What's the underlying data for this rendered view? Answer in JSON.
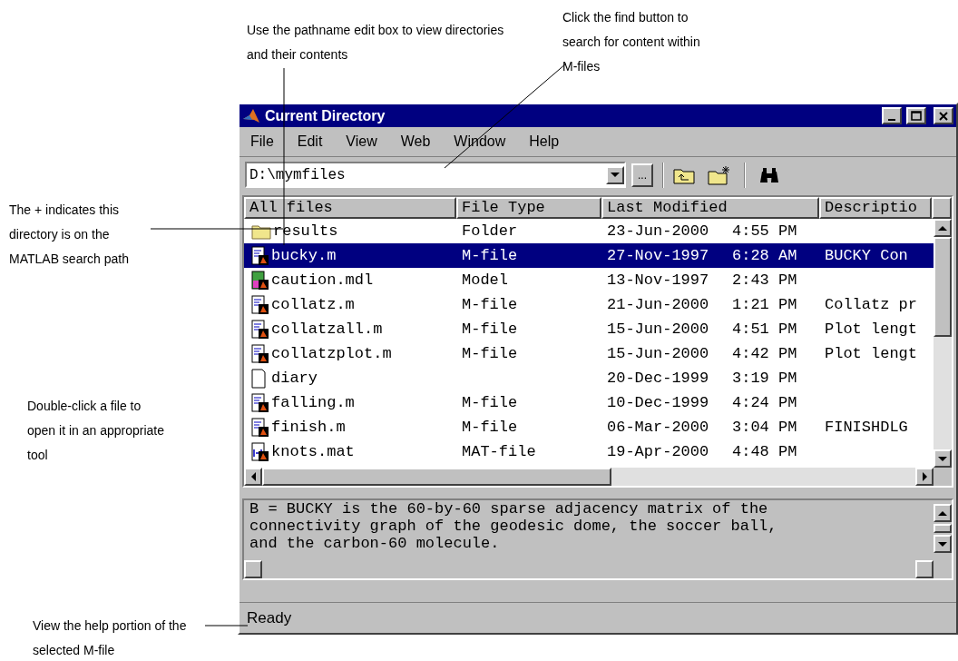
{
  "callouts": [
    {
      "kind": "pathname",
      "text": "Use the pathname edit box to view directories and their contents"
    },
    {
      "kind": "find",
      "text": "Click the find button to search for content within M-files"
    },
    {
      "kind": "plus",
      "text": "The + indicates this directory is on the MATLAB search path"
    },
    {
      "kind": "open",
      "text": "Double-click a file to open it in an appropriate tool"
    },
    {
      "kind": "help",
      "text": "View the help portion of the selected M-file"
    }
  ],
  "window": {
    "title": "Current Directory",
    "menu": [
      "File",
      "Edit",
      "View",
      "Web",
      "Window",
      "Help"
    ],
    "path": {
      "value": "D:\\mymfiles",
      "browse": "..."
    },
    "columns": [
      "All files",
      "File Type",
      "Last Modified",
      "Descriptio"
    ],
    "rows": [
      {
        "kind": "folder",
        "name": "results",
        "type": "Folder",
        "date": "23-Jun-2000",
        "time": "4:55 PM",
        "description": "",
        "selected": false
      },
      {
        "kind": "mfile",
        "name": "bucky.m",
        "type": "M-file",
        "date": "27-Nov-1997",
        "time": "6:28 AM",
        "description": "BUCKY  Con",
        "selected": true
      },
      {
        "kind": "model",
        "name": "caution.mdl",
        "type": "Model",
        "date": "13-Nov-1997",
        "time": "2:43 PM",
        "description": "",
        "selected": false
      },
      {
        "kind": "mfile",
        "name": "collatz.m",
        "type": "M-file",
        "date": "21-Jun-2000",
        "time": "1:21 PM",
        "description": "Collatz pr",
        "selected": false
      },
      {
        "kind": "mfile",
        "name": "collatzall.m",
        "type": "M-file",
        "date": "15-Jun-2000",
        "time": "4:51 PM",
        "description": "Plot lengt",
        "selected": false
      },
      {
        "kind": "mfile",
        "name": "collatzplot.m",
        "type": "M-file",
        "date": "15-Jun-2000",
        "time": "4:42 PM",
        "description": "Plot lengt",
        "selected": false
      },
      {
        "kind": "text",
        "name": "diary",
        "type": "",
        "date": "20-Dec-1999",
        "time": "3:19 PM",
        "description": "",
        "selected": false
      },
      {
        "kind": "mfile",
        "name": "falling.m",
        "type": "M-file",
        "date": "10-Dec-1999",
        "time": "4:24 PM",
        "description": "",
        "selected": false
      },
      {
        "kind": "mfile",
        "name": "finish.m",
        "type": "M-file",
        "date": "06-Mar-2000",
        "time": "3:04 PM",
        "description": "FINISHDLG",
        "selected": false
      },
      {
        "kind": "mat",
        "name": "knots.mat",
        "type": "MAT-file",
        "date": "19-Apr-2000",
        "time": "4:48 PM",
        "description": "",
        "selected": false
      }
    ],
    "help_lines": [
      "B = BUCKY is the 60-by-60 sparse adjacency matrix of the",
      "connectivity graph of the geodesic dome, the soccer ball,",
      "and the carbon-60 molecule."
    ],
    "status": "Ready"
  }
}
